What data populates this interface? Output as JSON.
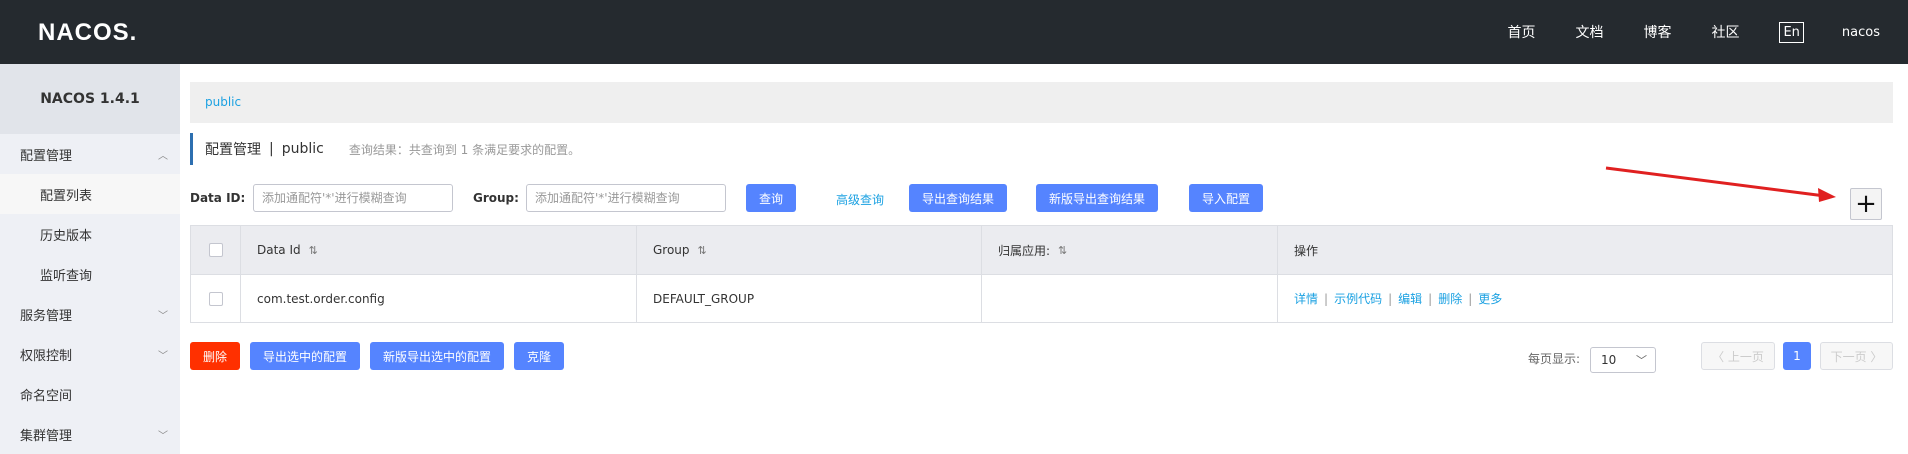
{
  "header": {
    "logo": "NACOS.",
    "nav": [
      "首页",
      "文档",
      "博客",
      "社区"
    ],
    "lang": "En",
    "user": "nacos"
  },
  "sidebar": {
    "version": "NACOS 1.4.1",
    "items": [
      {
        "label": "配置管理",
        "type": "top",
        "chevron": "up"
      },
      {
        "label": "配置列表",
        "type": "sub",
        "active": true
      },
      {
        "label": "历史版本",
        "type": "sub"
      },
      {
        "label": "监听查询",
        "type": "sub"
      },
      {
        "label": "服务管理",
        "type": "top",
        "chevron": "down"
      },
      {
        "label": "权限控制",
        "type": "top",
        "chevron": "down"
      },
      {
        "label": "命名空间",
        "type": "top"
      },
      {
        "label": "集群管理",
        "type": "top",
        "chevron": "down"
      }
    ]
  },
  "namespace_tab": "public",
  "title": {
    "main": "配置管理",
    "separator": "|",
    "namespace": "public",
    "info": "查询结果：共查询到 1 条满足要求的配置。"
  },
  "search": {
    "data_id_label": "Data ID:",
    "data_id_placeholder": "添加通配符'*'进行模糊查询",
    "group_label": "Group:",
    "group_placeholder": "添加通配符'*'进行模糊查询",
    "query_btn": "查询",
    "advanced_link": "高级查询",
    "export_btn": "导出查询结果",
    "new_export_btn": "新版导出查询结果",
    "import_btn": "导入配置"
  },
  "add_button": "+",
  "table": {
    "headers": [
      "Data Id",
      "Group",
      "归属应用:",
      "操作"
    ],
    "rows": [
      {
        "data_id": "com.test.order.config",
        "group": "DEFAULT_GROUP",
        "app": "",
        "ops": [
          "详情",
          "示例代码",
          "编辑",
          "删除",
          "更多"
        ]
      }
    ]
  },
  "bottom": {
    "delete_btn": "删除",
    "export_selected_btn": "导出选中的配置",
    "new_export_selected_btn": "新版导出选中的配置",
    "clone_btn": "克隆",
    "page_size_label": "每页显示:",
    "page_size": "10",
    "prev": "〈 上一页",
    "current_page": "1",
    "next": "下一页 〉"
  },
  "colors": {
    "topbar": "#252a2f",
    "primary": "#5584ff",
    "danger": "#ff3000",
    "link": "#1ba1e2",
    "annotation_arrow": "#e02020"
  }
}
